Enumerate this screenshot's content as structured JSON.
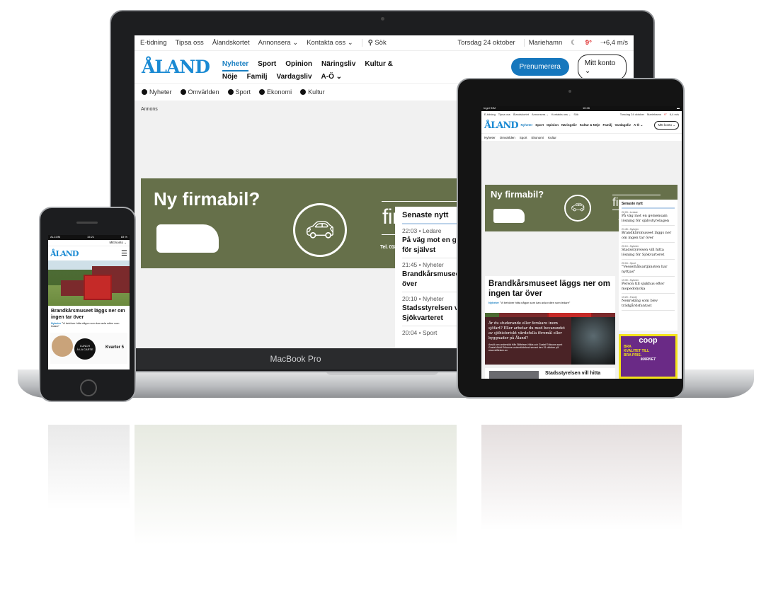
{
  "laptop": {
    "label": "MacBook Pro",
    "topbar": {
      "links": [
        "E-tidning",
        "Tipsa oss",
        "Ålandskortet",
        "Annonsera ⌄",
        "Kontakta oss ⌄"
      ],
      "search": "Sök",
      "date": "Torsdag 24 oktober",
      "city": "Mariehamn",
      "temp": "9°",
      "wind": "6,4 m/s"
    },
    "logo": "ÅLAND",
    "nav": [
      "Nyheter",
      "Sport",
      "Opinion",
      "Näringsliv",
      "Kultur & Nöje",
      "Familj",
      "Vardagsliv",
      "A-Ö ⌄"
    ],
    "subscribe": "Prenumerera",
    "account": "Mitt konto ⌄",
    "subnav": [
      "Nyheter",
      "Omvärlden",
      "Sport",
      "Ekonomi",
      "Kultur"
    ],
    "ad_label": "Annons",
    "ad": {
      "headline": "Ny firmabil?",
      "brand": "finans.",
      "contact": "Tel. 018 27610 • info@fin"
    },
    "latest": {
      "title": "Senaste nytt",
      "items": [
        {
          "time": "22:03",
          "cat": "Ledare",
          "title": "På väg mot en gem lösning för självst"
        },
        {
          "time": "21:45",
          "cat": "Nyheter",
          "title": "Brandkårsmuseet ingen tar över"
        },
        {
          "time": "20:10",
          "cat": "Nyheter",
          "title": "Stadsstyrelsen vil för Sjökvarteret"
        },
        {
          "time": "20:04",
          "cat": "Sport",
          "title": ""
        }
      ]
    }
  },
  "tablet": {
    "status": {
      "carrier": "Ingel SIM",
      "time": "10:26"
    },
    "ad": {
      "headline": "Ny firmabil?",
      "brand": "finans.ax",
      "contact": "Tel. 018 27610 • info@finans.ax"
    },
    "lead": {
      "title": "Brandkårsmuseet läggs ner om ingen tar över",
      "cat": "Nyheter",
      "quote": "\"Vi behöver hitta någon som kan axla rollen som ledare\""
    },
    "ad2": {
      "text": "Är du studerande eller forskare inom sjöfart? Eller arbetar du med bevarandet av sjöhistoriskt värdefulla föremål eller byggnader på Åland?",
      "small": "Ansök om understöd från Stiftelsen Hilda och Gustaf Eriksons samt Gustaf Adolf Eriksons understödsfond senast den 31 oktober på www.stiftelsen.ax"
    },
    "second": "Stadsstyrelsen vill hitta",
    "latest": [
      {
        "time": "22:03",
        "cat": "Ledare",
        "title": "På väg mot en gemensam lösning för självstyrelagen"
      },
      {
        "time": "21:45",
        "cat": "Nyheter",
        "title": "Brandkårsmuseet läggs ner om ingen tar över"
      },
      {
        "time": "20:10",
        "cat": "Nyheter",
        "title": "Stadsstyrelsen vill hitta lösning för Sjökvarteret"
      },
      {
        "time": "20:04",
        "cat": "Sport",
        "title": "\"Vesselhål­sartjänsten har nyttjas\""
      },
      {
        "time": "19:39",
        "cat": "Nyheter",
        "title": "Person till sjukhus efter mopedolycka"
      },
      {
        "time": "19:20",
        "cat": "Familj",
        "title": "Nenroking som blev trädgårdsfantast"
      }
    ],
    "coop": {
      "brand": "coop",
      "slogan": "BRA KVALITET TILL BRA PRIS.",
      "store": "MARKET"
    }
  },
  "phone": {
    "status": {
      "carrier": "ALCOM",
      "time": "15:21",
      "battery": "83 %"
    },
    "account": "Mitt konto ⌄",
    "lead": {
      "title": "Brandkårsmuseet läggs ner om ingen tar över",
      "cat": "Nyheter",
      "quote": "\"Vi behöver hitta någon som kan axla rollen som ledare\""
    },
    "ad": {
      "lunch": "LUNCH",
      "alacarte": "À LA CARTE",
      "brand": "Kvarter 5"
    }
  },
  "colors": {
    "brand": "#1a8ad3",
    "ad_green": "#66704a",
    "nav_active": "#1a7fc1"
  }
}
